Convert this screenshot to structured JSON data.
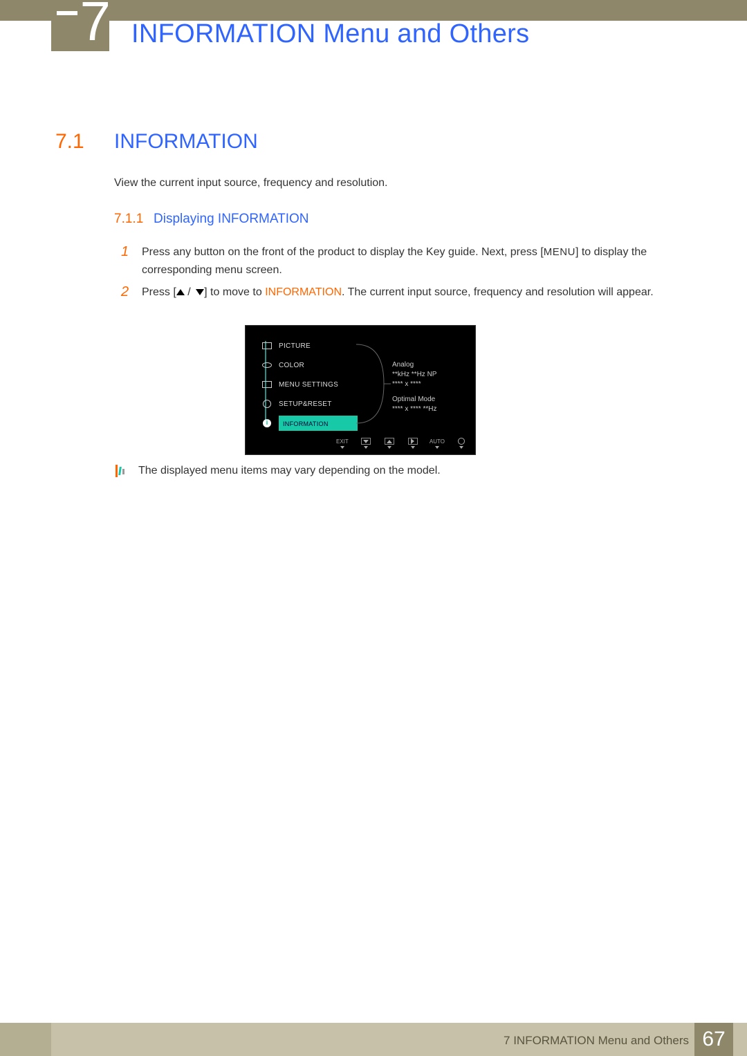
{
  "chapter": {
    "number": "7",
    "title": "INFORMATION Menu and Others"
  },
  "section": {
    "number": "7.1",
    "title": "INFORMATION"
  },
  "intro": "View the current input source, frequency and resolution.",
  "subsection": {
    "number": "7.1.1",
    "title": "Displaying INFORMATION"
  },
  "steps": {
    "s1": {
      "num": "1",
      "a": "Press any button on the front of the product to display the Key guide. Next, press [",
      "menu": "MENU",
      "b": "] to display the corresponding menu screen."
    },
    "s2": {
      "num": "2",
      "a": "Press [",
      "b": "] to move to ",
      "info": "INFORMATION",
      "c": ". The current input source, frequency and resolution will appear."
    }
  },
  "osd": {
    "items": [
      "PICTURE",
      "COLOR",
      "MENU SETTINGS",
      "SETUP&RESET",
      "INFORMATION"
    ],
    "info": {
      "signal": "Analog",
      "freq": "**kHz **Hz NP",
      "res": "**** x ****",
      "optimal_label": "Optimal Mode",
      "optimal": "**** x **** **Hz"
    },
    "buttons": {
      "exit": "EXIT",
      "auto": "AUTO"
    }
  },
  "note": "The displayed menu items may vary depending on the model.",
  "footer": {
    "text": "7 INFORMATION Menu and Others",
    "page": "67"
  }
}
